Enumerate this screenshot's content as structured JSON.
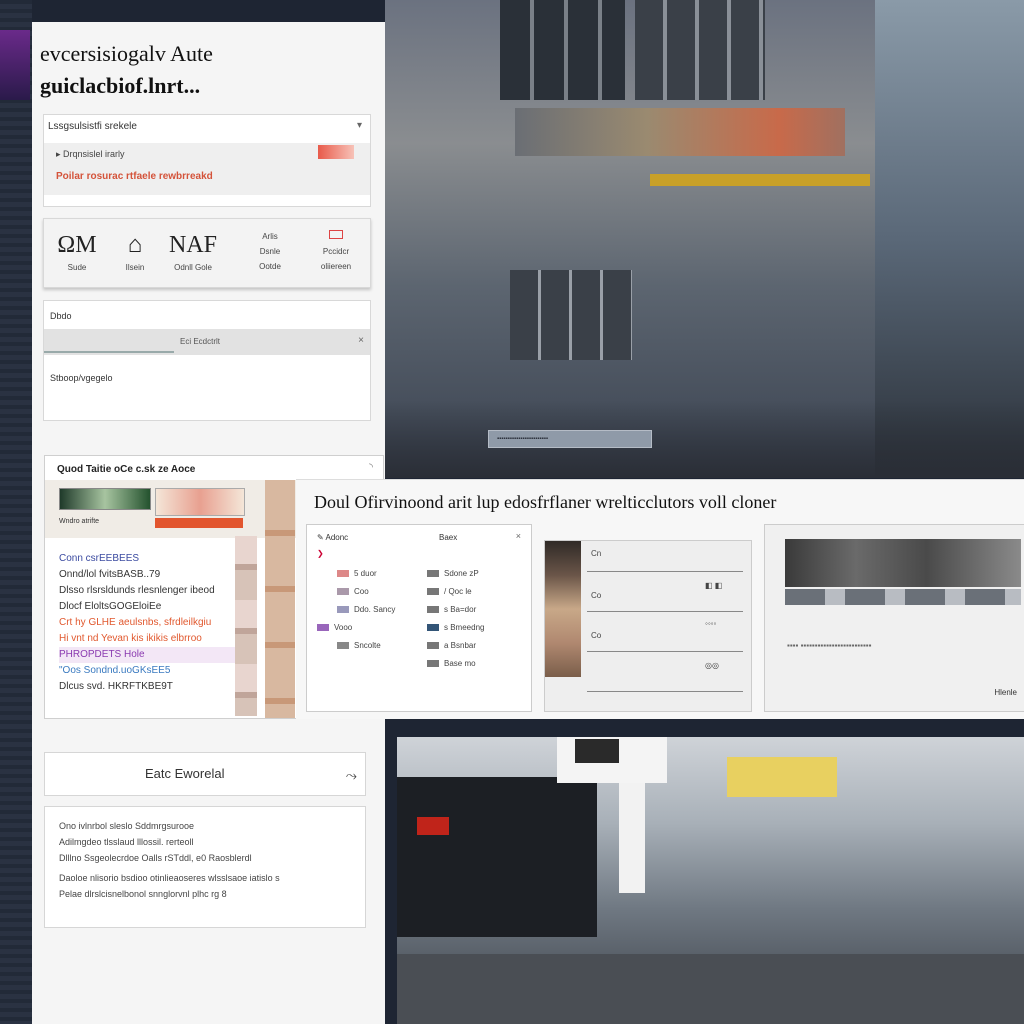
{
  "panel": {
    "title_line1": "evcersisiogalv Aute",
    "title_line2": "guiclacbiof.lnrt..."
  },
  "card1": {
    "header": "Lssgsulsistfi srekele",
    "chevron": "▾",
    "row_label": "▸   Drqnsislel irarly",
    "row_sub": "Poilar rosurac rtfaele rewbrreakd"
  },
  "card2": {
    "tools": [
      {
        "glyph": "ΩΜ",
        "label": "Sude"
      },
      {
        "glyph": "⌂",
        "label": "Ilsein"
      },
      {
        "glyph": "NAF",
        "label": "Odnll Gole"
      }
    ],
    "col1": {
      "top": "Arlis",
      "mid": "Dsnle",
      "bot": "Ootde"
    },
    "col2": {
      "mid": "Pccidcr",
      "bot": "oliiereen"
    }
  },
  "card3": {
    "label": "Dbdo",
    "bar_value": "Eci  Ecdctrlt",
    "sub": "Stboop/vgegelo"
  },
  "photo_top": {
    "chip_text": "   ▪▪▪▪▪▪▪▪▪▪▪▪▪▪▪▪▪▪▪▪▪▪▪▪"
  },
  "gallery": {
    "header": "Quod Taitie  oCe  c.sk  ze  Aoce",
    "chevron": "◝",
    "thumb_caption": "Wndro  atrifte",
    "list": [
      {
        "text": "Conn csrEEBEES",
        "color": "#3a4aa0"
      },
      {
        "text": "Onnd/lol fvitsBASB..79",
        "color": "#222"
      },
      {
        "text": "Dlsso rlsrsldunds rlesnlenger ibeod",
        "color": "#222"
      },
      {
        "text": "Dlocf EloltsGOGEloiEe",
        "color": "#222"
      },
      {
        "text": "Crt hy GLHE aeulsnbs, sfrdleilkgiu",
        "color": "#e1582e"
      },
      {
        "text": "Hi vnt nd Yevan kis ikikis elbrroo",
        "color": "#e1582e"
      },
      {
        "text": "PHROPDETS   Hole",
        "color": "#8a3ab0"
      },
      {
        "text": "",
        "color": "#222"
      },
      {
        "text": "\"Oos Sondnd.uoGKsEE5",
        "color": "#3a7ac0"
      },
      {
        "text": "Dlcus svd. HKRFTKBE9T",
        "color": "#222"
      }
    ]
  },
  "overlay": {
    "heading": "Doul Ofirvinoond arit lup edosfrflaner wrelticclutors voll cloner",
    "dialog": {
      "h1": "✎ Adonc",
      "h2": "Baex",
      "close": "×",
      "items_left": [
        {
          "label": "❯",
          "color": "#c03"
        },
        {
          "label": "5 duor",
          "color": "#d88"
        },
        {
          "label": "Coo",
          "color": "#a9a"
        },
        {
          "label": "Ddo. Sancy",
          "color": "#99b"
        },
        {
          "label": "Vooo",
          "color": "#96b"
        },
        {
          "label": "Sncolte",
          "color": "#888"
        }
      ],
      "items_right": [
        {
          "label": "Sdone zP",
          "color": "#555"
        },
        {
          "label": "/ Qoc le",
          "color": "#555"
        },
        {
          "label": "s Ba=dor",
          "color": "#555"
        },
        {
          "label": "s Bmeedng",
          "color": "#555"
        },
        {
          "label": "a Bsnbar",
          "color": "#357"
        },
        {
          "label": "Base mo",
          "color": "#555"
        }
      ]
    },
    "panelA": {
      "rows": [
        "Cn",
        "Co",
        "Co"
      ],
      "marks": [
        "◧ ◧",
        "◦◦◦◦",
        "◎◎"
      ]
    },
    "panelB": {
      "caption": "Hlenle",
      "dots": "▪▪▪▪  ▪▪▪▪▪▪▪▪▪▪▪▪▪▪▪▪▪▪▪▪▪▪▪▪▪"
    }
  },
  "footer_card": {
    "label": "Eatc  Eworelal",
    "arrow": "⤳"
  },
  "text_card": {
    "lines": [
      "Ono ivlnrbol sleslo Sddmrgsurooe",
      "Adilmgdeo tlsslaud lllossil. rerteoll",
      "Dlllno Ssgeolecrdoe Oalls rSTddl, e0 Raosblerdl",
      "Daoloe nlisorio bsdioo otinlieaoseres wlsslsaoe iatislo s",
      "Pelae dlrslcisnelbonol snnglorvnl plhc rg 8"
    ]
  }
}
